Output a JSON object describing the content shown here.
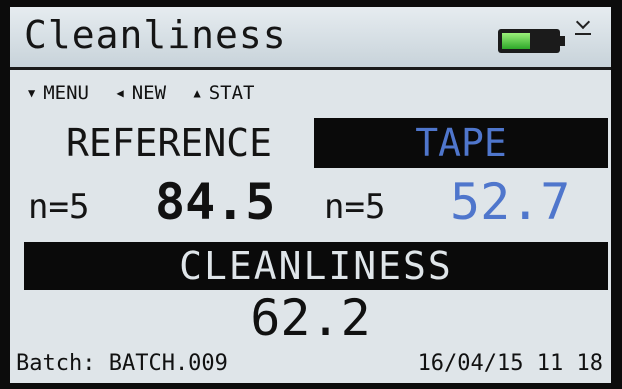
{
  "header": {
    "title": "Cleanliness",
    "battery_icon": "battery-icon",
    "usb_icon": "usb-icon"
  },
  "menu": {
    "items": [
      {
        "icon": "triangle-down-icon",
        "glyph": "▼",
        "label": "MENU"
      },
      {
        "icon": "triangle-left-icon",
        "glyph": "◀",
        "label": "NEW"
      },
      {
        "icon": "triangle-up-icon",
        "glyph": "▲",
        "label": "STAT"
      }
    ]
  },
  "reference": {
    "label": "REFERENCE",
    "n": "n=5",
    "value": "84.5"
  },
  "tape": {
    "label": "TAPE",
    "n": "n=5",
    "value": "52.7"
  },
  "cleanliness": {
    "label": "CLEANLINESS",
    "value": "62.2"
  },
  "footer": {
    "batch": "Batch: BATCH.009",
    "datetime": "16/04/15 11 18"
  },
  "colors": {
    "screen_bg": "#dfe5e9",
    "bar_bg": "#0a0a0a",
    "tape_blue": "#4f76cc",
    "battery_green": "#2ea82a"
  }
}
